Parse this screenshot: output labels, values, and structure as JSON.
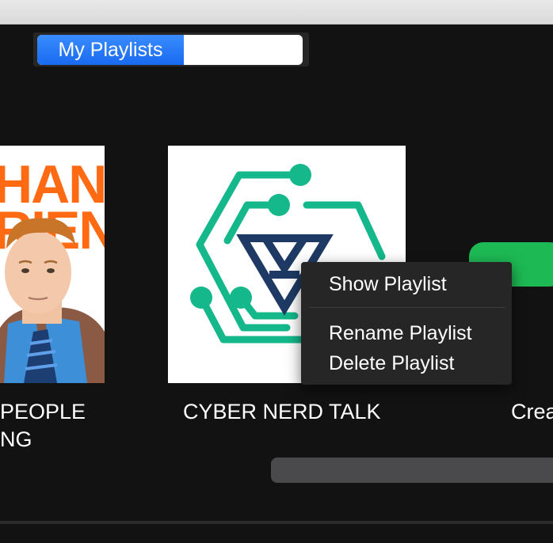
{
  "segmented_control": {
    "active_label": "My Playlists"
  },
  "cards": [
    {
      "cover_text_1": "HAN",
      "cover_text_2": "RIEN",
      "title_line1": "PEOPLE",
      "title_line2": "NG"
    },
    {
      "title": "CYBER NERD TALK"
    },
    {
      "title": "Crea"
    }
  ],
  "context_menu": {
    "items": [
      "Show Playlist",
      "Rename Playlist",
      "Delete Playlist"
    ]
  },
  "colors": {
    "accent_blue": "#1a6af0",
    "spotify_green": "#1db954",
    "logo_green": "#14b88a",
    "logo_navy": "#1e3a64",
    "conan_orange": "#ff6a13"
  }
}
